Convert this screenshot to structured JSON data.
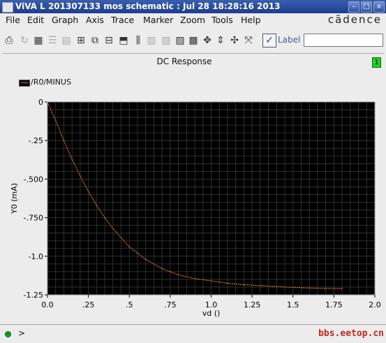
{
  "window": {
    "title": "ViVA L  201307133 mos schematic : Jul 28 18:28:16 2013",
    "buttons": [
      "minimize-icon",
      "maximize-icon",
      "close-icon"
    ]
  },
  "menu": [
    "File",
    "Edit",
    "Graph",
    "Axis",
    "Trace",
    "Marker",
    "Zoom",
    "Tools",
    "Help"
  ],
  "brand": "cādence",
  "toolbar": {
    "icons": [
      "print-icon",
      "redraw-icon",
      "grid-icon",
      "strip-icon",
      "composite-icon",
      "zoom-icon",
      "subwindow-icon",
      "delete-window-icon",
      "split-icon",
      "bar-icon",
      "table-icon",
      "stack-icon",
      "calculator-icon",
      "fit-icon",
      "zoom-y-icon",
      "pan-icon",
      "zoom-box-icon"
    ],
    "label_check_text": "Label",
    "label_input_value": ""
  },
  "plot": {
    "title": "DC Response",
    "subwindow_badge": "1"
  },
  "status": {
    "prompt": ">",
    "command": ""
  },
  "watermark": "bbs.eetop.cn",
  "colors": {
    "titlebar": "#2a4aa0",
    "plot_bg": "#000000",
    "grid": "#3a3a3a",
    "trace": "#e07828",
    "badge": "#1ed21e"
  },
  "chart_data": {
    "type": "line",
    "title": "DC Response",
    "xlabel": "vd ()",
    "ylabel": "Y0 (mA)",
    "xlim": [
      0.0,
      2.0
    ],
    "ylim": [
      -1.25,
      0
    ],
    "x_ticks": [
      0.0,
      0.25,
      0.5,
      0.75,
      1.0,
      1.25,
      1.5,
      1.75,
      2.0
    ],
    "x_tick_labels": [
      "0.0",
      ".25",
      ".5",
      ".75",
      "1.0",
      "1.25",
      "1.5",
      "1.75",
      "2.0"
    ],
    "y_ticks": [
      0,
      -0.25,
      -0.5,
      -0.75,
      -1.0,
      -1.25
    ],
    "y_tick_labels": [
      "0",
      "-.25",
      "-.500",
      "-.750",
      "-1.0",
      "-1.25"
    ],
    "grid": true,
    "legend_position": "top-left",
    "series": [
      {
        "name": "/R0/MINUS",
        "x": [
          0.0,
          0.05,
          0.1,
          0.15,
          0.2,
          0.25,
          0.3,
          0.35,
          0.4,
          0.45,
          0.5,
          0.55,
          0.6,
          0.65,
          0.7,
          0.75,
          0.8,
          0.9,
          1.0,
          1.1,
          1.2,
          1.3,
          1.4,
          1.5,
          1.6,
          1.7,
          1.8
        ],
        "y": [
          0.0,
          -0.12,
          -0.25,
          -0.37,
          -0.48,
          -0.58,
          -0.67,
          -0.75,
          -0.82,
          -0.88,
          -0.94,
          -0.98,
          -1.02,
          -1.05,
          -1.08,
          -1.1,
          -1.12,
          -1.145,
          -1.16,
          -1.175,
          -1.185,
          -1.19,
          -1.197,
          -1.202,
          -1.206,
          -1.209,
          -1.21
        ]
      }
    ]
  }
}
